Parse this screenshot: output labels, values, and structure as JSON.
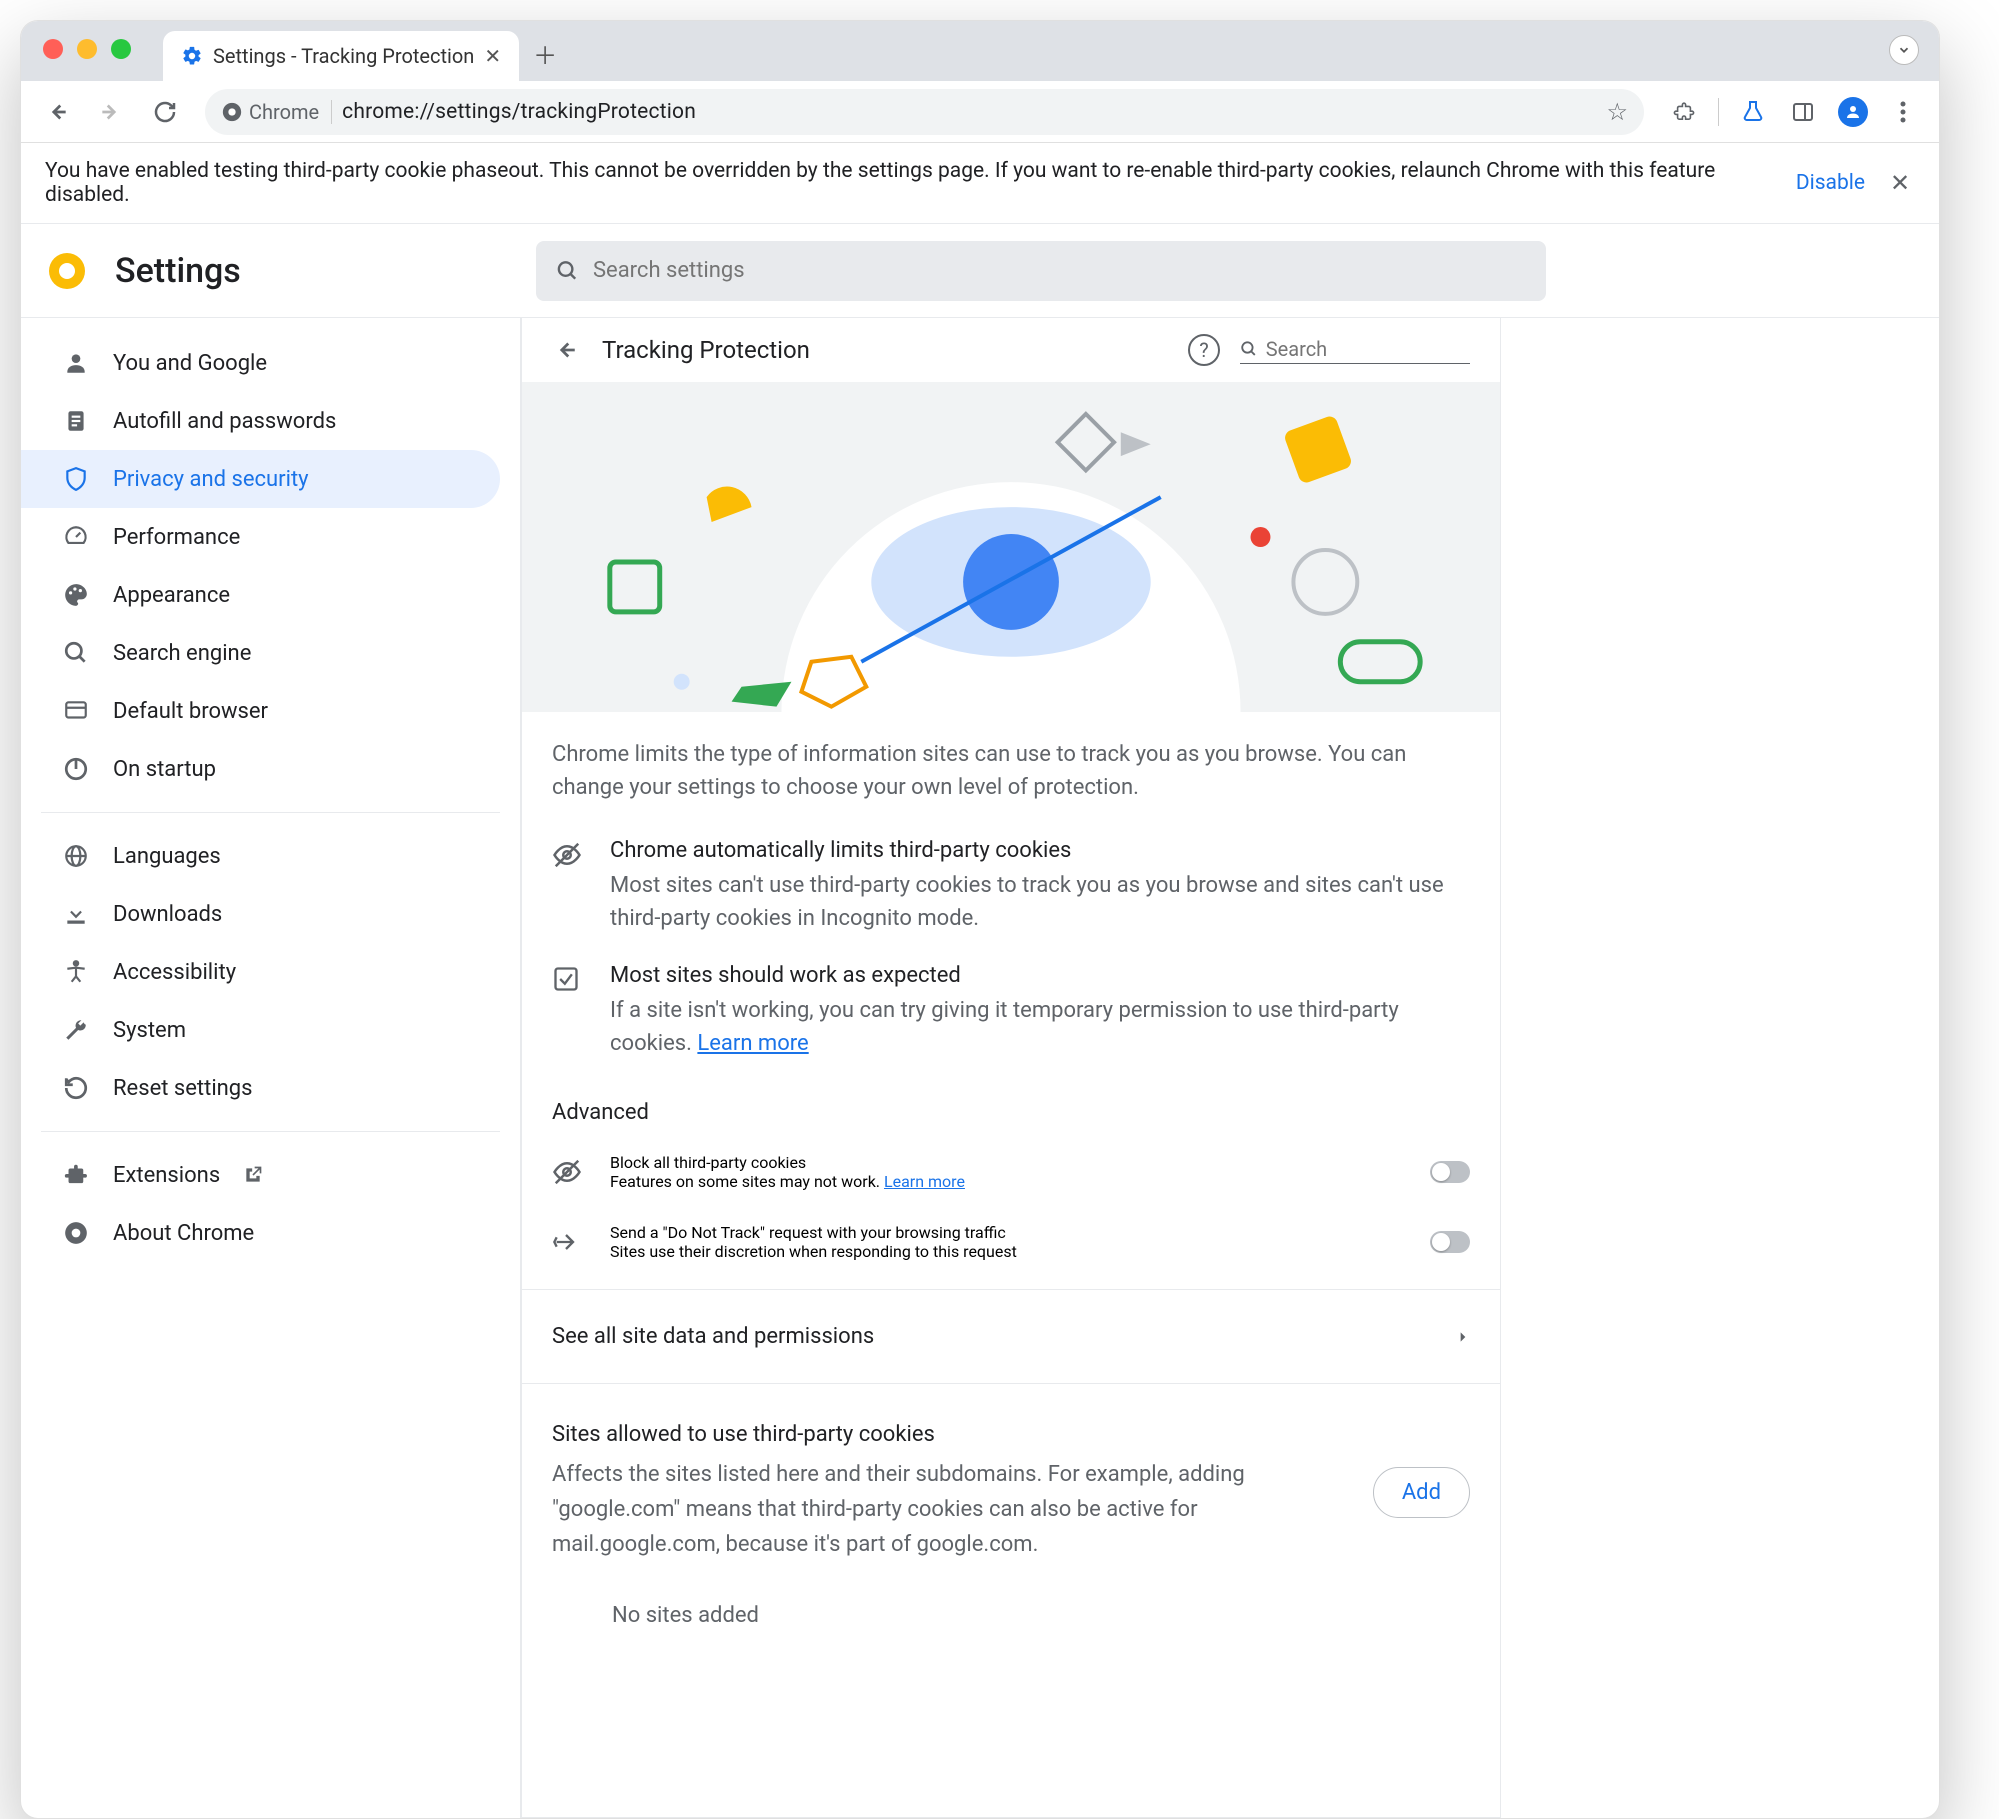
{
  "window": {
    "tab_title": "Settings - Tracking Protection",
    "url_label": "Chrome",
    "url": "chrome://settings/trackingProtection"
  },
  "infobar": {
    "text": "You have enabled testing third-party cookie phaseout. This cannot be overridden by the settings page. If you want to re-enable third-party cookies, relaunch Chrome with this feature disabled.",
    "link": "Disable"
  },
  "app": {
    "title": "Settings",
    "search_placeholder": "Search settings"
  },
  "sidebar": {
    "items": [
      {
        "label": "You and Google"
      },
      {
        "label": "Autofill and passwords"
      },
      {
        "label": "Privacy and security"
      },
      {
        "label": "Performance"
      },
      {
        "label": "Appearance"
      },
      {
        "label": "Search engine"
      },
      {
        "label": "Default browser"
      },
      {
        "label": "On startup"
      }
    ],
    "group2": [
      {
        "label": "Languages"
      },
      {
        "label": "Downloads"
      },
      {
        "label": "Accessibility"
      },
      {
        "label": "System"
      },
      {
        "label": "Reset settings"
      }
    ],
    "group3": [
      {
        "label": "Extensions"
      },
      {
        "label": "About Chrome"
      }
    ]
  },
  "content": {
    "title": "Tracking Protection",
    "search_placeholder": "Search",
    "intro": "Chrome limits the type of information sites can use to track you as you browse. You can change your settings to choose your own level of protection.",
    "info1": {
      "title": "Chrome automatically limits third-party cookies",
      "desc": "Most sites can't use third-party cookies to track you as you browse and sites can't use third-party cookies in Incognito mode."
    },
    "info2": {
      "title": "Most sites should work as expected",
      "desc": "If a site isn't working, you can try giving it temporary permission to use third-party cookies. ",
      "link": "Learn more"
    },
    "advanced_label": "Advanced",
    "toggle1": {
      "title": "Block all third-party cookies",
      "desc": "Features on some sites may not work. ",
      "link": "Learn more"
    },
    "toggle2": {
      "title": "Send a \"Do Not Track\" request with your browsing traffic",
      "desc": "Sites use their discretion when responding to this request"
    },
    "all_sites": "See all site data and permissions",
    "sites_section": {
      "title": "Sites allowed to use third-party cookies",
      "desc": "Affects the sites listed here and their subdomains. For example, adding \"google.com\" means that third-party cookies can also be active for mail.google.com, because it's part of google.com.",
      "add": "Add",
      "empty": "No sites added"
    }
  }
}
